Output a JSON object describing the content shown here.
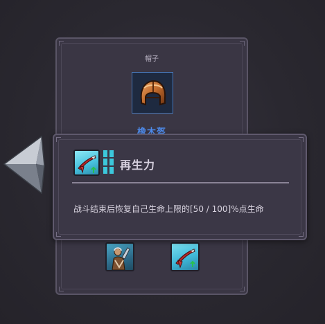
{
  "item_panel": {
    "slot_label": "帽子",
    "item_name": "橡木盔",
    "item_icon": "oak-helmet-icon",
    "bottom_skills": [
      {
        "icon": "barbarian-warrior-icon"
      },
      {
        "icon": "regeneration-skill-icon"
      }
    ]
  },
  "tooltip": {
    "skill_name": "再生力",
    "skill_icon": "regeneration-skill-icon",
    "level_indicator": "level-bars-icon",
    "description": "战斗结束后恢复自己生命上限的[50 / 100]%点生命"
  },
  "colors": {
    "panel_bg": "#3a3644",
    "item_name": "#4f8ef0",
    "level_bar": "#3cc8dc",
    "text": "#d9d4e0"
  }
}
